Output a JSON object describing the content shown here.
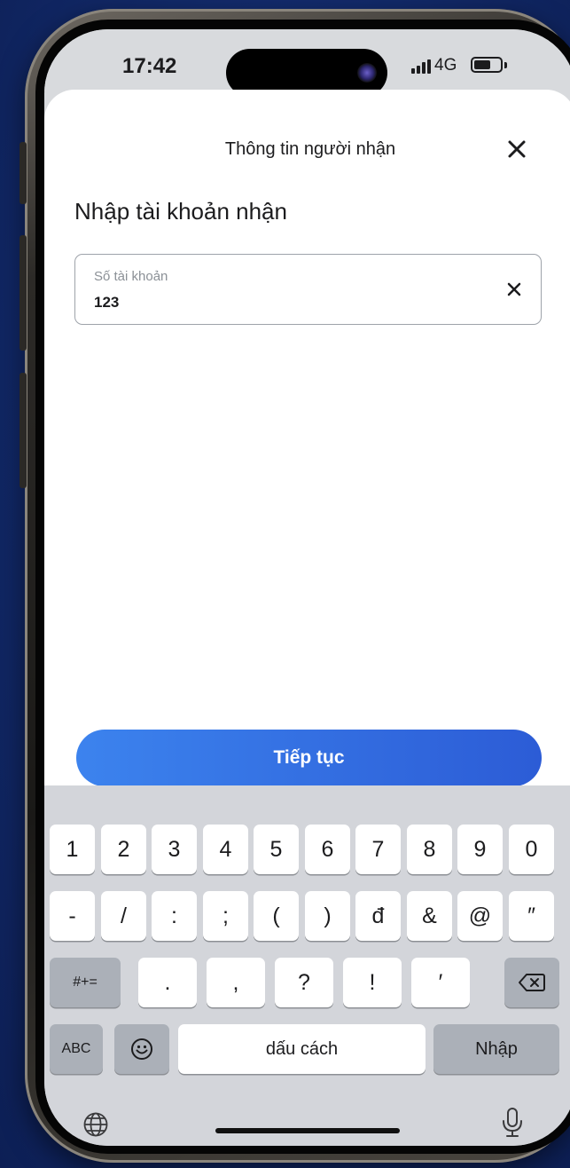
{
  "status_bar": {
    "time": "17:42",
    "network": "4G"
  },
  "sheet": {
    "title": "Thông tin người nhận",
    "section_title": "Nhập tài khoản nhận",
    "account_field": {
      "label": "Số tài khoản",
      "value": "123"
    },
    "continue_label": "Tiếp tục"
  },
  "keyboard": {
    "row1": [
      "1",
      "2",
      "3",
      "4",
      "5",
      "6",
      "7",
      "8",
      "9",
      "0"
    ],
    "row2": [
      "-",
      "/",
      ":",
      ";",
      "(",
      ")",
      "đ",
      "&",
      "@",
      "″"
    ],
    "row3_mode": "#+=",
    "row3": [
      ".",
      ",",
      "?",
      "!",
      "′"
    ],
    "abc_label": "ABC",
    "space_label": "dấu cách",
    "return_label": "Nhập",
    "icons": {
      "backspace": "backspace-icon",
      "emoji": "emoji-icon",
      "globe": "globe-icon",
      "mic": "microphone-icon",
      "close": "close-icon"
    }
  },
  "colors": {
    "accent_start": "#3c83ee",
    "accent_end": "#2c5cd6",
    "background": "#132c6e"
  }
}
